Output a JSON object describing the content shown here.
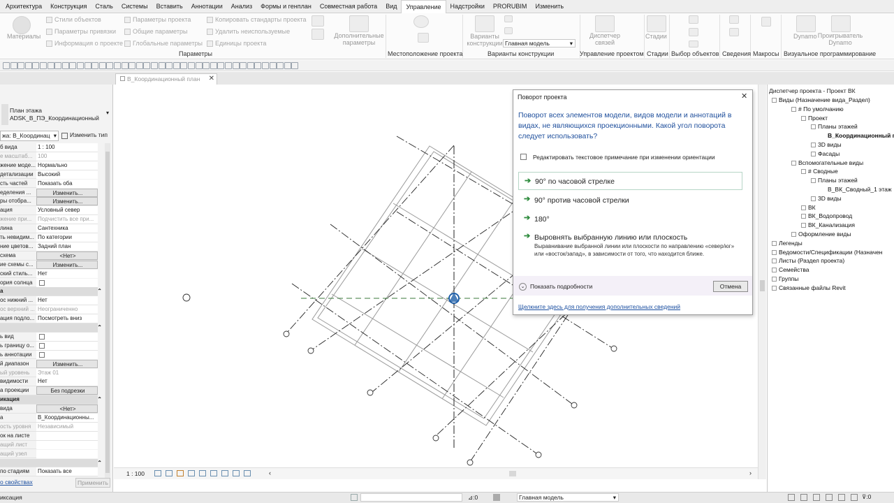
{
  "ribbon_tabs": [
    "Архитектура",
    "Конструкция",
    "Сталь",
    "Системы",
    "Вставить",
    "Аннотации",
    "Анализ",
    "Формы и генплан",
    "Совместная работа",
    "Вид",
    "Управление",
    "Надстройки",
    "PRORUBIM",
    "Изменить"
  ],
  "active_tab": "Управление",
  "ribbon": {
    "materials": "Материалы",
    "settings_col1": [
      "Стили объектов",
      "Параметры привязки",
      "Информация о проекте"
    ],
    "settings_col2": [
      "Параметры проекта",
      "Общие параметры",
      "Глобальные параметры"
    ],
    "settings_col3": [
      "Копировать стандарты проекта",
      "Удалить неиспользуемые",
      "Единицы проекта"
    ],
    "additional_params": "Дополнительные параметры",
    "design_options": "Варианты конструкции",
    "main_model": "Главная модель",
    "phase_manager": "Диспетчер связей",
    "phases": "Стадии",
    "dynamo": "Dynamo",
    "dynamo_player": "Проигрыватель Dynamo",
    "groups": [
      "Параметры",
      "Местоположение проекта",
      "Варианты конструкции",
      "Управление проектом",
      "Стадии",
      "Выбор объектов",
      "Сведения",
      "Макросы",
      "Визуальное программирование"
    ]
  },
  "view_tab": {
    "label": "В_Координационный план"
  },
  "properties": {
    "type_name": "План этажа",
    "type_sub": "ADSK_В_ПЭ_Координационный",
    "selector": "жа: В_Координац",
    "edit_type": "Изменить тип",
    "rows": [
      {
        "l": "б вида",
        "v": "1 : 100",
        "k": "val"
      },
      {
        "l": "е масштаб...",
        "v": "100",
        "k": "gray"
      },
      {
        "l": "жение моде...",
        "v": "Нормально",
        "k": "val"
      },
      {
        "l": "детализации",
        "v": "Высокий",
        "k": "val"
      },
      {
        "l": "сть частей",
        "v": "Показать оба",
        "k": "val"
      },
      {
        "l": "еделения ...",
        "v": "Изменить...",
        "k": "btn"
      },
      {
        "l": "ры отобра...",
        "v": "Изменить...",
        "k": "btn"
      },
      {
        "l": "ация",
        "v": "Условный север",
        "k": "val"
      },
      {
        "l": "жение при...",
        "v": "Подчистить все при...",
        "k": "gray"
      },
      {
        "l": "лина",
        "v": "Сантехника",
        "k": "val"
      },
      {
        "l": "ть невидим...",
        "v": "По категории",
        "k": "val"
      },
      {
        "l": "ние цветов...",
        "v": "Задний план",
        "k": "val"
      },
      {
        "l": "схема",
        "v": "<Нет>",
        "k": "btn"
      },
      {
        "l": "ие схемы с...",
        "v": "Изменить...",
        "k": "btn"
      },
      {
        "l": "ский стиль...",
        "v": "Нет",
        "k": "val"
      },
      {
        "l": "ория солнца",
        "v": "",
        "k": "cb"
      },
      {
        "l": "а",
        "v": "",
        "k": "head"
      },
      {
        "l": "ос нижний ...",
        "v": "Нет",
        "k": "val"
      },
      {
        "l": "ос верхний ...",
        "v": "Неограниченно",
        "k": "gray"
      },
      {
        "l": "ация подло...",
        "v": "Посмотреть вниз",
        "k": "val"
      },
      {
        "l": "",
        "v": "",
        "k": "head"
      },
      {
        "l": "ь вид",
        "v": "",
        "k": "cb"
      },
      {
        "l": "ь границу о...",
        "v": "",
        "k": "cb"
      },
      {
        "l": "ь аннотации",
        "v": "",
        "k": "cb"
      },
      {
        "l": "й диапазон",
        "v": "Изменить...",
        "k": "btn"
      },
      {
        "l": "ый уровень",
        "v": "Этаж 01",
        "k": "gray"
      },
      {
        "l": "видимости",
        "v": "Нет",
        "k": "val"
      },
      {
        "l": "а проекции",
        "v": "Без подрезки",
        "k": "btn"
      },
      {
        "l": "икация",
        "v": "",
        "k": "head"
      },
      {
        "l": "вида",
        "v": "<Нет>",
        "k": "btn"
      },
      {
        "l": "а",
        "v": "В_Координационны...",
        "k": "val"
      },
      {
        "l": "ость уровня",
        "v": "Независимый",
        "k": "gray"
      },
      {
        "l": "ок на листе",
        "v": "",
        "k": "val"
      },
      {
        "l": "ащий лист",
        "v": "",
        "k": "gray"
      },
      {
        "l": "ащий узел",
        "v": "",
        "k": "gray"
      },
      {
        "l": "",
        "v": "",
        "k": "head"
      },
      {
        "l": "по стадиям",
        "v": "Показать все",
        "k": "val"
      }
    ],
    "help_link": "о свойствах",
    "apply": "Применить"
  },
  "canvas": {
    "scale": "1 : 100"
  },
  "dialog": {
    "title": "Поворот проекта",
    "question": "Поворот всех элементов модели, видов модели и аннотаций в видах, не являющихся проекционными.  Какой угол поворота следует использовать?",
    "checkbox": "Редактировать текстовое примечание при изменении ориентации",
    "options": [
      "90° по часовой стрелке",
      "90° против часовой стрелки",
      "180°",
      "Выровнять выбранную линию или плоскость"
    ],
    "align_desc": "Выравнивание выбранной линии или плоскости по направлению «север/юг» или «восток/запад», в зависимости от того, что находится ближе.",
    "details": "Показать подробности",
    "cancel": "Отмена",
    "help_link": "Щелкните здесь для получения дополнительных сведений"
  },
  "browser": {
    "title": "Диспетчер проекта - Проект ВК",
    "nodes": [
      "Виды (Назначение вида_Раздел)",
      "# По умолчанию",
      "Проект",
      "Планы этажей",
      "В_Координационный пла",
      "3D виды",
      "Фасады",
      "Вспомогательные виды",
      "# Сводные",
      "Планы этажей",
      "В_ВК_Сводный_1 этаж",
      "3D виды",
      "ВК",
      "ВК_Водопровод",
      "ВК_Канализация",
      "Оформление виды",
      "Легенды",
      "Ведомости/Спецификации (Назначен",
      "Листы (Раздел проекта)",
      "Семейства",
      "Группы",
      "Связанные файлы Revit"
    ]
  },
  "statusbar": {
    "left": "иксация",
    "coords": ":0",
    "model": "Главная модель",
    "filter": ":0"
  },
  "colors": {
    "accent": "#1f5fa8",
    "arrow": "#2e8b3d",
    "link": "#1a4ea0"
  }
}
